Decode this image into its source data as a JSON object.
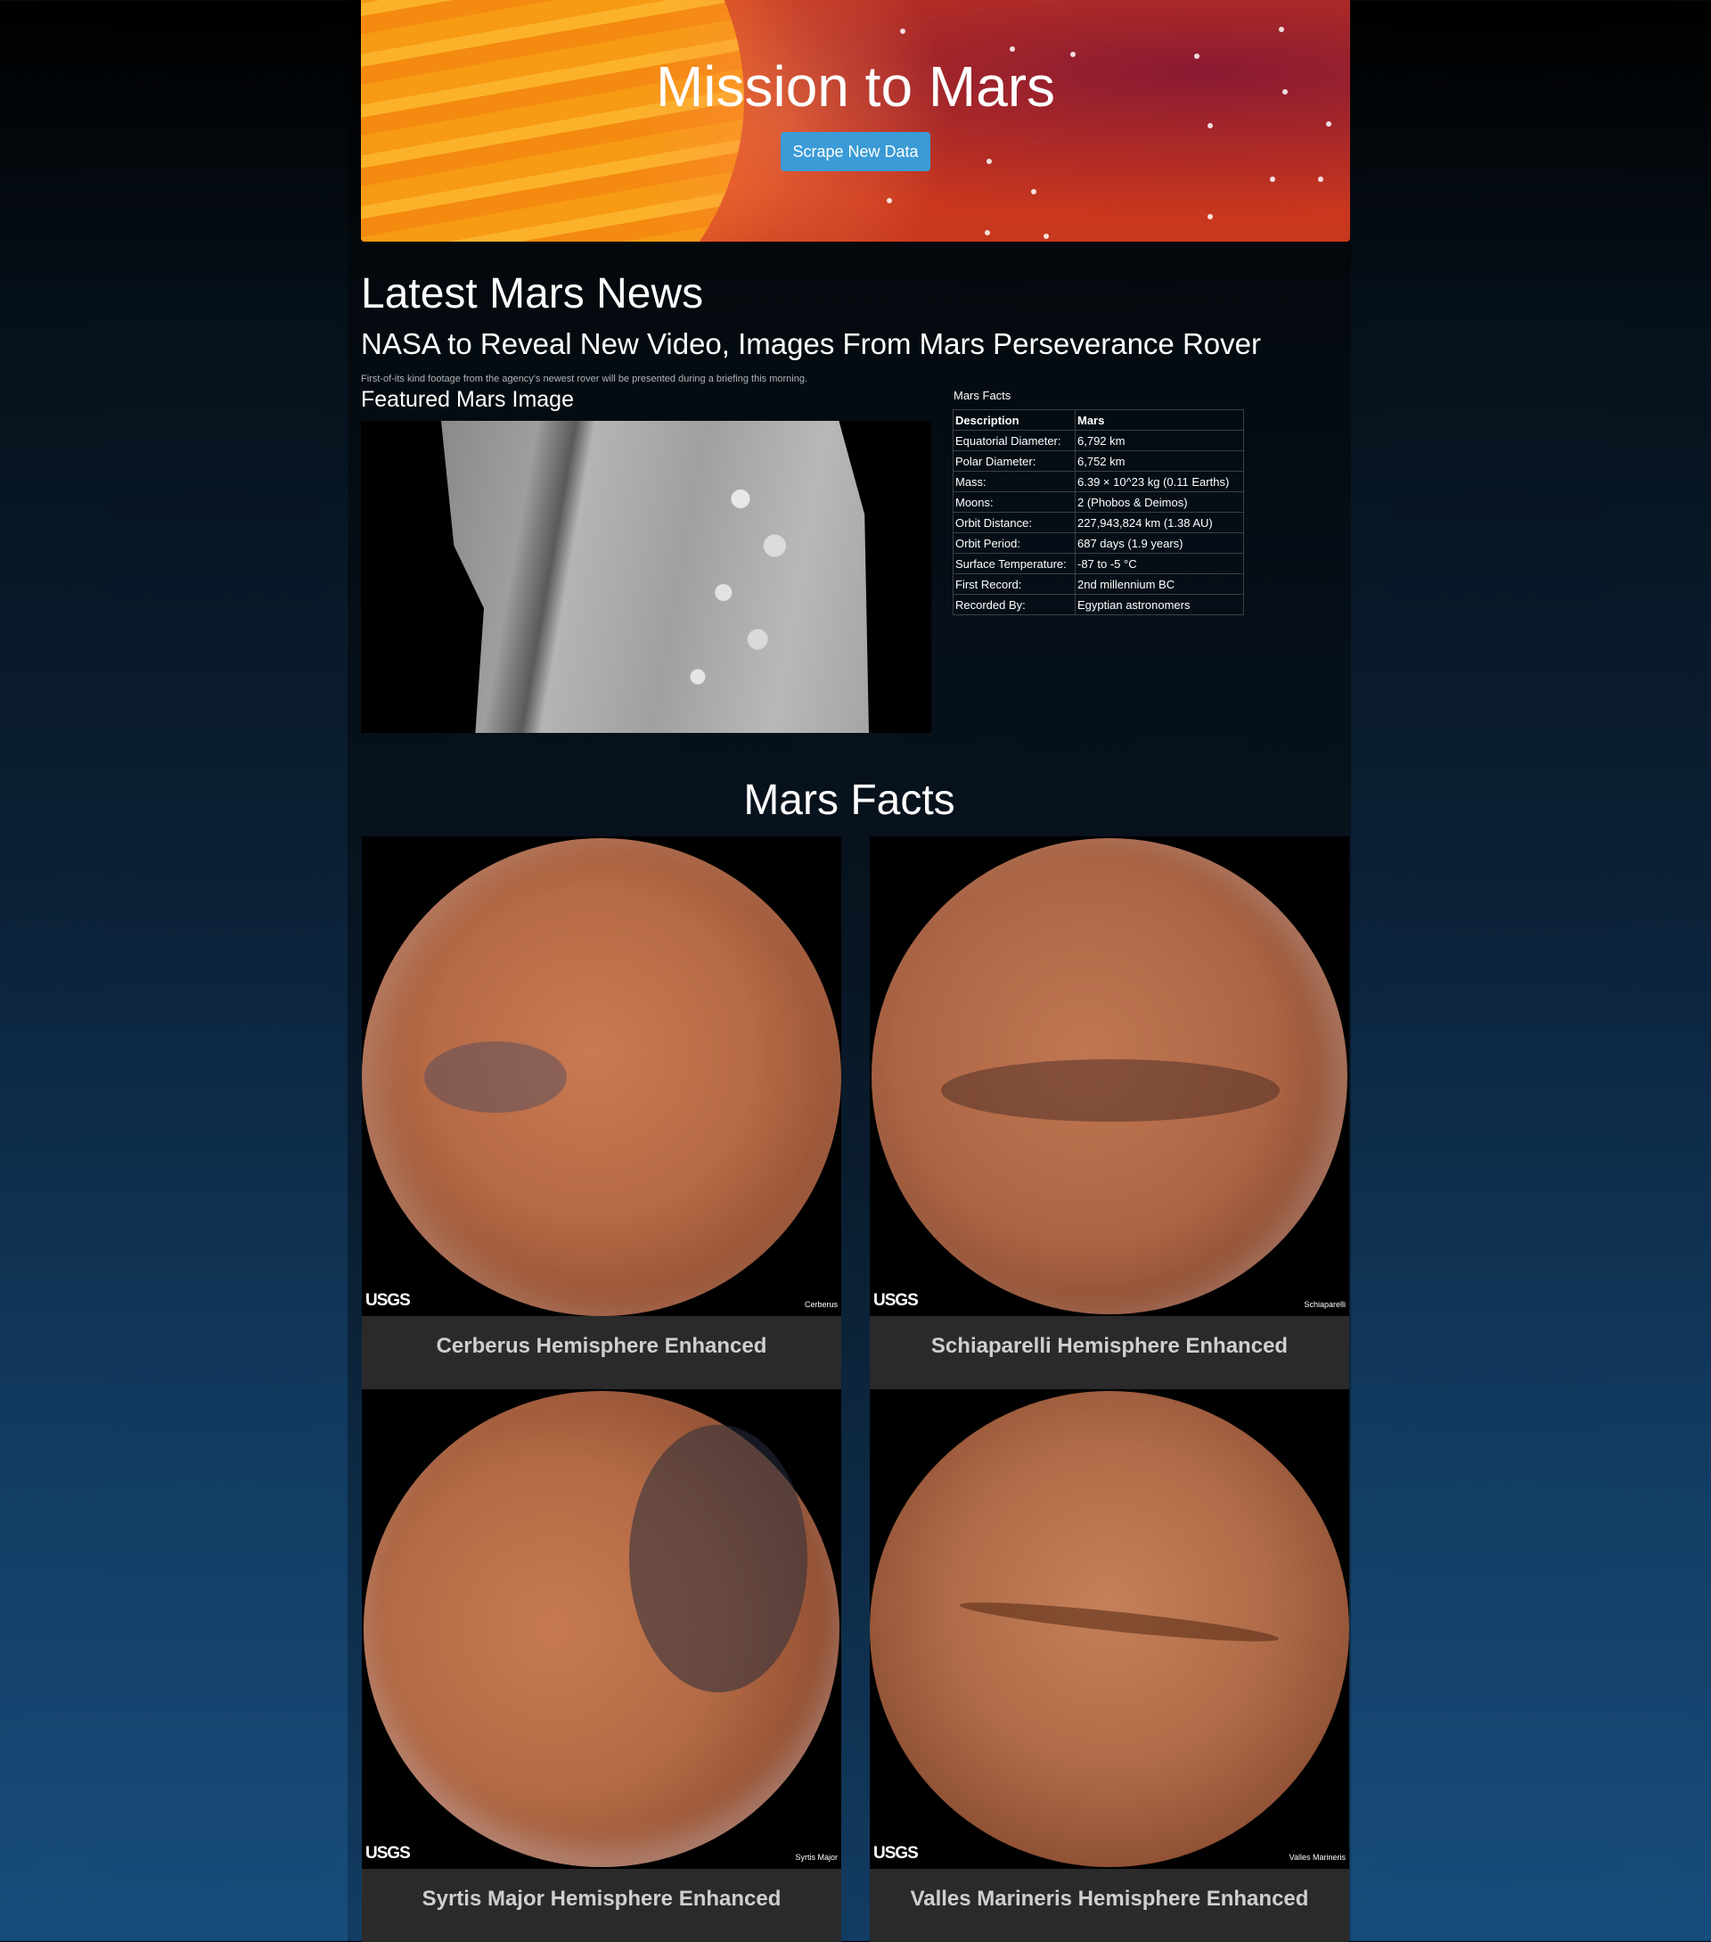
{
  "hero": {
    "title": "Mission to Mars",
    "scrape_button": "Scrape New Data"
  },
  "news": {
    "heading": "Latest Mars News",
    "title": "NASA to Reveal New Video, Images From Mars Perseverance Rover",
    "teaser": "First-of-its kind footage from the agency's newest rover will be presented during a briefing this morning."
  },
  "featured": {
    "heading": "Featured Mars Image"
  },
  "facts": {
    "caption": "Mars Facts",
    "header": [
      "Description",
      "Mars"
    ],
    "rows": [
      [
        "Equatorial Diameter:",
        "6,792 km"
      ],
      [
        "Polar Diameter:",
        "6,752 km"
      ],
      [
        "Mass:",
        "6.39 × 10^23 kg (0.11 Earths)"
      ],
      [
        "Moons:",
        "2 (Phobos & Deimos)"
      ],
      [
        "Orbit Distance:",
        "227,943,824 km (1.38 AU)"
      ],
      [
        "Orbit Period:",
        "687 days (1.9 years)"
      ],
      [
        "Surface Temperature:",
        "-87 to -5 °C"
      ],
      [
        "First Record:",
        "2nd millennium BC"
      ],
      [
        "Recorded By:",
        "Egyptian astronomers"
      ]
    ]
  },
  "hemispheres": {
    "heading": "Mars Facts",
    "logo_text": "USGS",
    "items": [
      {
        "title": "Cerberus Hemisphere Enhanced",
        "label": "Cerberus"
      },
      {
        "title": "Schiaparelli Hemisphere Enhanced",
        "label": "Schiaparelli"
      },
      {
        "title": "Syrtis Major Hemisphere Enhanced",
        "label": "Syrtis Major"
      },
      {
        "title": "Valles Marineris Hemisphere Enhanced",
        "label": "Valles Marineris"
      }
    ]
  },
  "colors": {
    "button": "#3a9bd6",
    "card_bg": "#2a2a2a",
    "hero_red": "#c23a1c",
    "sun_orange": "#f79a14"
  }
}
